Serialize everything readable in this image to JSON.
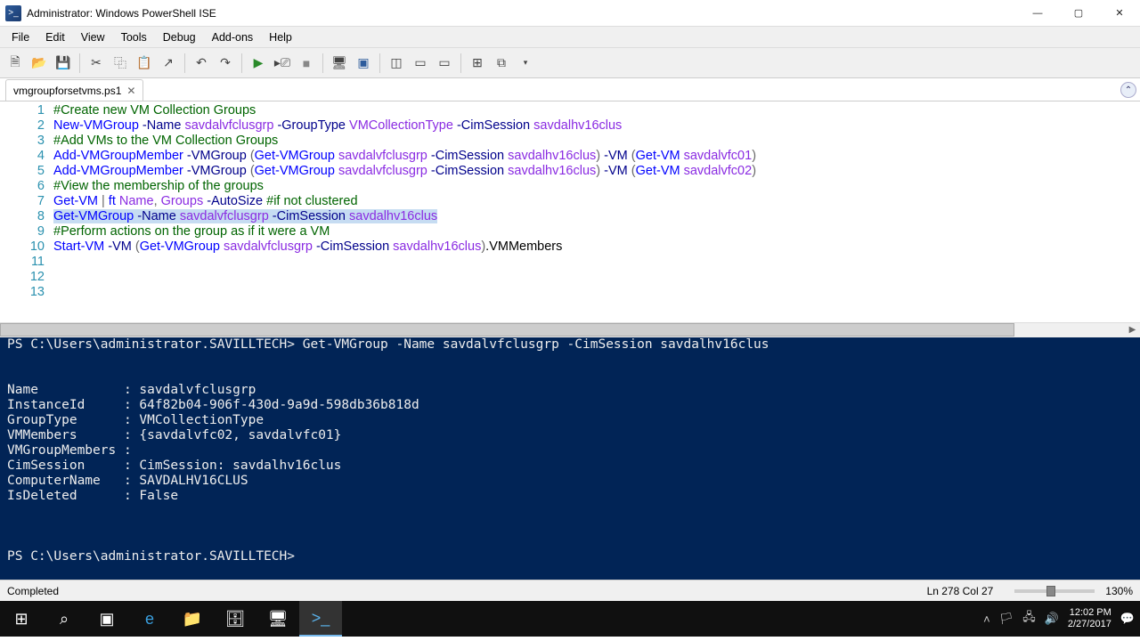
{
  "window": {
    "title": "Administrator: Windows PowerShell ISE"
  },
  "menubar": [
    "File",
    "Edit",
    "View",
    "Tools",
    "Debug",
    "Add-ons",
    "Help"
  ],
  "tab": {
    "name": "vmgroupforsetvms.ps1"
  },
  "code_lines": [
    {
      "n": 1,
      "t": [
        [
          "c-comment",
          "#Create new VM Collection Groups"
        ]
      ]
    },
    {
      "n": 2,
      "t": [
        [
          "c-cmd",
          "New-VMGroup"
        ],
        [
          "c-text",
          " "
        ],
        [
          "c-param",
          "-Name"
        ],
        [
          "c-text",
          " "
        ],
        [
          "c-arg",
          "savdalvfclusgrp"
        ],
        [
          "c-text",
          " "
        ],
        [
          "c-param",
          "-GroupType"
        ],
        [
          "c-text",
          " "
        ],
        [
          "c-arg",
          "VMCollectionType"
        ],
        [
          "c-text",
          " "
        ],
        [
          "c-param",
          "-CimSession"
        ],
        [
          "c-text",
          " "
        ],
        [
          "c-arg",
          "savdalhv16clus"
        ]
      ]
    },
    {
      "n": 3,
      "t": [
        [
          "c-text",
          ""
        ]
      ]
    },
    {
      "n": 4,
      "t": [
        [
          "c-comment",
          "#Add VMs to the VM Collection Groups"
        ]
      ]
    },
    {
      "n": 5,
      "t": [
        [
          "c-cmd",
          "Add-VMGroupMember"
        ],
        [
          "c-text",
          " "
        ],
        [
          "c-param",
          "-VMGroup"
        ],
        [
          "c-text",
          " "
        ],
        [
          "c-op",
          "("
        ],
        [
          "c-cmd",
          "Get-VMGroup"
        ],
        [
          "c-text",
          " "
        ],
        [
          "c-arg",
          "savdalvfclusgrp"
        ],
        [
          "c-text",
          " "
        ],
        [
          "c-param",
          "-CimSession"
        ],
        [
          "c-text",
          " "
        ],
        [
          "c-arg",
          "savdalhv16clus"
        ],
        [
          "c-op",
          ")"
        ],
        [
          "c-text",
          " "
        ],
        [
          "c-param",
          "-VM"
        ],
        [
          "c-text",
          " "
        ],
        [
          "c-op",
          "("
        ],
        [
          "c-cmd",
          "Get-VM"
        ],
        [
          "c-text",
          " "
        ],
        [
          "c-arg",
          "savdalvfc01"
        ],
        [
          "c-op",
          ")"
        ]
      ]
    },
    {
      "n": 6,
      "t": [
        [
          "c-cmd",
          "Add-VMGroupMember"
        ],
        [
          "c-text",
          " "
        ],
        [
          "c-param",
          "-VMGroup"
        ],
        [
          "c-text",
          " "
        ],
        [
          "c-op",
          "("
        ],
        [
          "c-cmd",
          "Get-VMGroup"
        ],
        [
          "c-text",
          " "
        ],
        [
          "c-arg",
          "savdalvfclusgrp"
        ],
        [
          "c-text",
          " "
        ],
        [
          "c-param",
          "-CimSession"
        ],
        [
          "c-text",
          " "
        ],
        [
          "c-arg",
          "savdalhv16clus"
        ],
        [
          "c-op",
          ")"
        ],
        [
          "c-text",
          " "
        ],
        [
          "c-param",
          "-VM"
        ],
        [
          "c-text",
          " "
        ],
        [
          "c-op",
          "("
        ],
        [
          "c-cmd",
          "Get-VM"
        ],
        [
          "c-text",
          " "
        ],
        [
          "c-arg",
          "savdalvfc02"
        ],
        [
          "c-op",
          ")"
        ]
      ]
    },
    {
      "n": 7,
      "t": [
        [
          "c-text",
          ""
        ]
      ]
    },
    {
      "n": 8,
      "t": [
        [
          "c-comment",
          "#View the membership of the groups"
        ]
      ]
    },
    {
      "n": 9,
      "t": [
        [
          "c-cmd",
          "Get-VM"
        ],
        [
          "c-text",
          " "
        ],
        [
          "c-op",
          "|"
        ],
        [
          "c-text",
          " "
        ],
        [
          "c-cmd",
          "ft"
        ],
        [
          "c-text",
          " "
        ],
        [
          "c-arg",
          "Name"
        ],
        [
          "c-op",
          ","
        ],
        [
          "c-text",
          " "
        ],
        [
          "c-arg",
          "Groups"
        ],
        [
          "c-text",
          " "
        ],
        [
          "c-param",
          "-AutoSize"
        ],
        [
          "c-text",
          " "
        ],
        [
          "c-comment",
          "#if not clustered"
        ]
      ]
    },
    {
      "n": 10,
      "sel": true,
      "t": [
        [
          "c-cmd",
          "Get-VMGroup"
        ],
        [
          "c-text",
          " "
        ],
        [
          "c-param",
          "-Name"
        ],
        [
          "c-text",
          " "
        ],
        [
          "c-arg",
          "savdalvfclusgrp"
        ],
        [
          "c-text",
          " "
        ],
        [
          "c-param",
          "-CimSession"
        ],
        [
          "c-text",
          " "
        ],
        [
          "c-arg",
          "savdalhv16clus"
        ]
      ]
    },
    {
      "n": 11,
      "t": [
        [
          "c-text",
          ""
        ]
      ]
    },
    {
      "n": 12,
      "t": [
        [
          "c-comment",
          "#Perform actions on the group as if it were a VM"
        ]
      ]
    },
    {
      "n": 13,
      "t": [
        [
          "c-cmd",
          "Start-VM"
        ],
        [
          "c-text",
          " "
        ],
        [
          "c-param",
          "-VM"
        ],
        [
          "c-text",
          " "
        ],
        [
          "c-op",
          "("
        ],
        [
          "c-cmd",
          "Get-VMGroup"
        ],
        [
          "c-text",
          " "
        ],
        [
          "c-arg",
          "savdalvfclusgrp"
        ],
        [
          "c-text",
          " "
        ],
        [
          "c-param",
          "-CimSession"
        ],
        [
          "c-text",
          " "
        ],
        [
          "c-arg",
          "savdalhv16clus"
        ],
        [
          "c-op",
          ")"
        ],
        [
          "c-text",
          "."
        ],
        [
          "c-text",
          "VMMembers"
        ]
      ]
    }
  ],
  "console_lines": [
    "PS C:\\Users\\administrator.SAVILLTECH> Get-VMGroup -Name savdalvfclusgrp -CimSession savdalhv16clus",
    "",
    "",
    "Name           : savdalvfclusgrp",
    "InstanceId     : 64f82b04-906f-430d-9a9d-598db36b818d",
    "GroupType      : VMCollectionType",
    "VMMembers      : {savdalvfc02, savdalvfc01}",
    "VMGroupMembers :",
    "CimSession     : CimSession: savdalhv16clus",
    "ComputerName   : SAVDALHV16CLUS",
    "IsDeleted      : False",
    "",
    "",
    "",
    "PS C:\\Users\\administrator.SAVILLTECH>"
  ],
  "status": {
    "left": "Completed",
    "pos": "Ln 278  Col 27",
    "zoom": "130%"
  },
  "taskbar": {
    "time": "12:02 PM",
    "date": "2/27/2017"
  }
}
